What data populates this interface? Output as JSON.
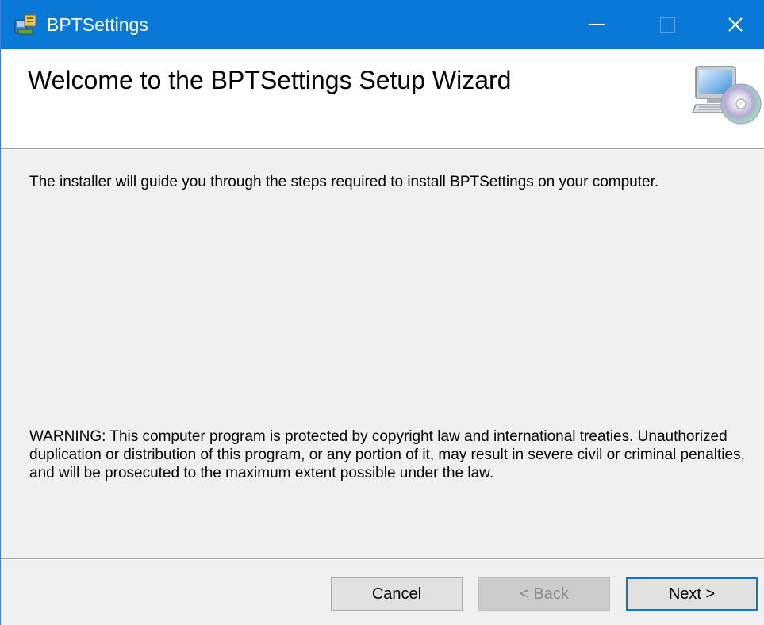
{
  "window": {
    "title": "BPTSettings",
    "app_icon": "installer-icon",
    "controls": {
      "minimize": "minimize-icon",
      "maximize": "maximize-icon",
      "close": "close-icon",
      "close_glyph": "✕"
    },
    "accent_color": "#0a78d7"
  },
  "header": {
    "title": "Welcome to the BPTSettings Setup Wizard",
    "icon": "computer-cd-icon"
  },
  "body": {
    "intro": "The installer will guide you through the steps required to install BPTSettings on your computer.",
    "warning": "WARNING: This computer program is protected by copyright law and international treaties. Unauthorized duplication or distribution of this program, or any portion of it, may result in severe civil or criminal penalties, and will be prosecuted to the maximum extent possible under the law."
  },
  "buttons": {
    "cancel": "Cancel",
    "back": "< Back",
    "next": "Next >"
  }
}
